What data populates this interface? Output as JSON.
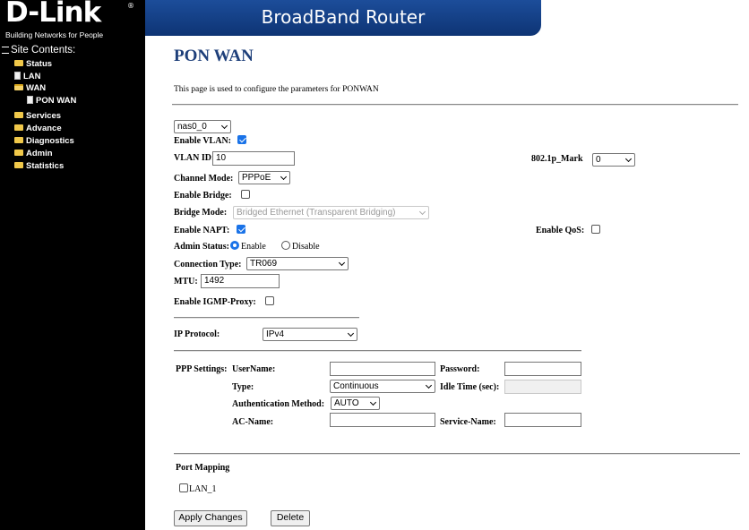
{
  "sidebar": {
    "logo_text": "D-Link",
    "logo_reg": "®",
    "tagline": "Building Networks for People",
    "tree_title": "Site Contents:",
    "items": [
      {
        "label": "Status"
      },
      {
        "label": "LAN"
      },
      {
        "label": "WAN"
      },
      {
        "label": "PON WAN"
      },
      {
        "label": "Services"
      },
      {
        "label": "Advance"
      },
      {
        "label": "Diagnostics"
      },
      {
        "label": "Admin"
      },
      {
        "label": "Statistics"
      }
    ]
  },
  "header": {
    "title": "BroadBand Router",
    "bg": "#123c82"
  },
  "page": {
    "title": "PON WAN",
    "description": "This page is used to configure the parameters for PONWAN"
  },
  "form": {
    "interface_select": "nas0_0",
    "enable_vlan_label": "Enable VLAN:",
    "enable_vlan_checked": true,
    "vlan_id_label": "VLAN ID:",
    "vlan_id_value": "10",
    "mark_label": "802.1p_Mark",
    "mark_value": "0",
    "channel_mode_label": "Channel Mode:",
    "channel_mode_value": "PPPoE",
    "enable_bridge_label": "Enable Bridge:",
    "enable_bridge_checked": false,
    "bridge_mode_label": "Bridge Mode:",
    "bridge_mode_value": "Bridged Ethernet (Transparent Bridging)",
    "enable_napt_label": "Enable NAPT:",
    "enable_napt_checked": true,
    "enable_qos_label": "Enable QoS:",
    "enable_qos_checked": false,
    "admin_status_label": "Admin Status:",
    "admin_enable_label": "Enable",
    "admin_disable_label": "Disable",
    "admin_status_value": "Enable",
    "connection_type_label": "Connection Type:",
    "connection_type_value": "TR069",
    "mtu_label": "MTU:",
    "mtu_value": "1492",
    "igmp_label": "Enable IGMP-Proxy:",
    "igmp_checked": false,
    "ip_protocol_label": "IP Protocol:",
    "ip_protocol_value": "IPv4"
  },
  "ppp": {
    "section_label": "PPP Settings:",
    "username_label": "UserName:",
    "username_value": "",
    "password_label": "Password:",
    "password_value": "",
    "type_label": "Type:",
    "type_value": "Continuous",
    "idle_time_label": "Idle Time (sec):",
    "idle_time_value": "",
    "auth_label": "Authentication Method:",
    "auth_value": "AUTO",
    "ac_name_label": "AC-Name:",
    "ac_name_value": "",
    "service_name_label": "Service-Name:",
    "service_name_value": ""
  },
  "port_mapping": {
    "title": "Port Mapping",
    "ports": [
      {
        "label": "LAN_1",
        "checked": false
      }
    ]
  },
  "buttons": {
    "apply": "Apply Changes",
    "delete": "Delete"
  }
}
